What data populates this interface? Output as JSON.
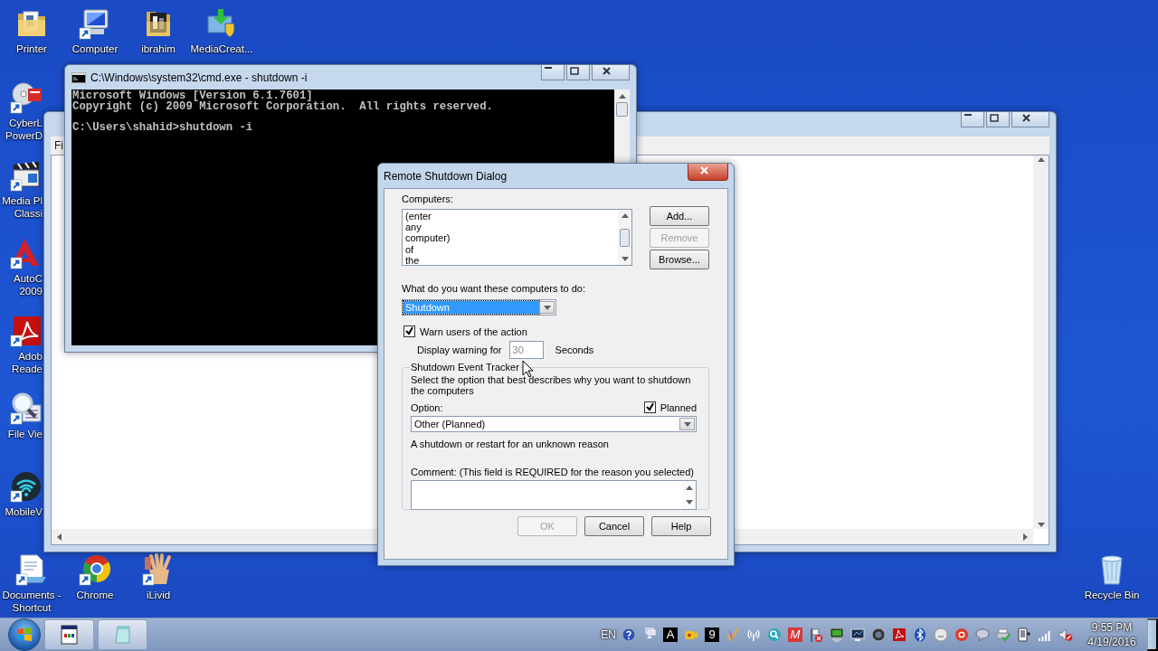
{
  "desktop_icons": {
    "top_row": [
      {
        "label": [
          "Printer"
        ],
        "kind": "folder",
        "shortcut": false
      },
      {
        "label": [
          "Computer"
        ],
        "kind": "computer",
        "shortcut": true
      },
      {
        "label": [
          "ibrahim"
        ],
        "kind": "photo-folder",
        "shortcut": false
      },
      {
        "label": [
          "MediaCreat..."
        ],
        "kind": "installer",
        "shortcut": false
      }
    ],
    "left_column": [
      {
        "label": [
          "CyberL",
          "PowerD"
        ],
        "kind": "disc",
        "shortcut": true
      },
      {
        "label": [
          "Media Pl",
          "Classi"
        ],
        "kind": "clapper",
        "shortcut": true
      },
      {
        "label": [
          "AutoC",
          "2009"
        ],
        "kind": "autocad",
        "shortcut": true
      },
      {
        "label": [
          "Adob",
          "Reade"
        ],
        "kind": "pdf",
        "shortcut": true
      },
      {
        "label": [
          "File Vie"
        ],
        "kind": "magnifier",
        "shortcut": true
      },
      {
        "label": [
          "MobileV"
        ],
        "kind": "wifi",
        "shortcut": true
      }
    ],
    "bottom_row": [
      {
        "label": [
          "Documents -",
          "Shortcut"
        ],
        "kind": "document",
        "shortcut": true
      },
      {
        "label": [
          "Chrome"
        ],
        "kind": "browser",
        "shortcut": true
      },
      {
        "label": [
          "iLivid"
        ],
        "kind": "hand",
        "shortcut": true
      }
    ],
    "right_column": [
      {
        "label": [
          "Recycle Bin"
        ],
        "kind": "bin",
        "shortcut": false
      }
    ]
  },
  "back_window": {
    "menu": "Fi"
  },
  "console_window": {
    "title": "C:\\Windows\\system32\\cmd.exe - shutdown -i",
    "output": [
      "Microsoft Windows [Version 6.1.7601]",
      "Copyright (c) 2009 Microsoft Corporation.  All rights reserved."
    ],
    "prompt": "C:\\Users\\shahid>shutdown -i"
  },
  "dialog": {
    "title": "Remote Shutdown Dialog",
    "computers_label": "Computers:",
    "computers_list": [
      "(enter",
      "any",
      "computer)",
      "of",
      "the"
    ],
    "buttons": [
      {
        "label": "Add...",
        "disabled": false
      },
      {
        "label": "Remove",
        "disabled": true
      },
      {
        "label": "Browse...",
        "disabled": false
      }
    ],
    "action_label": "What do you want these computers to do:",
    "action": {
      "value": "Shutdown",
      "focused": true
    },
    "warn": {
      "label": "Warn users of the action",
      "checked": true
    },
    "warning_label": "Display warning for",
    "warning_value": "30",
    "warning_unit": "Seconds",
    "tracker": {
      "title": "Shutdown Event Tracker",
      "description": "Select the option that best describes why you want to shutdown the computers",
      "option_label": "Option:",
      "planned": {
        "label": "Planned",
        "checked": true
      },
      "option": "Other (Planned)",
      "option_description": "A shutdown or restart for an unknown reason",
      "comment_label": "Comment: (This field is REQUIRED for the reason you selected)"
    },
    "footer_buttons": [
      {
        "label": "OK",
        "disabled": true
      },
      {
        "label": "Cancel",
        "disabled": false
      },
      {
        "label": "Help",
        "disabled": false
      }
    ]
  },
  "taskbar": {
    "tasks": [
      {
        "kind": "window"
      },
      {
        "kind": "notepad"
      }
    ],
    "tray": {
      "language": "EN",
      "icons": [
        {
          "kind": "help"
        },
        {
          "kind": "show-hidden"
        },
        {
          "kind": "letter",
          "glyph": "A"
        },
        {
          "kind": "camera"
        },
        {
          "kind": "letter",
          "glyph": "9"
        },
        {
          "kind": "check"
        },
        {
          "kind": "antenna"
        },
        {
          "kind": "search"
        },
        {
          "kind": "red-letter",
          "glyph": "M"
        },
        {
          "kind": "flag"
        },
        {
          "kind": "monitor-green"
        },
        {
          "kind": "monitor"
        },
        {
          "kind": "webcam"
        },
        {
          "kind": "pdf"
        },
        {
          "kind": "bluetooth"
        },
        {
          "kind": "face"
        },
        {
          "kind": "ring"
        },
        {
          "kind": "speech"
        },
        {
          "kind": "printer"
        },
        {
          "kind": "device"
        },
        {
          "kind": "signal"
        },
        {
          "kind": "speaker-muted"
        }
      ],
      "time": "9:55 PM",
      "date": "4/19/2016"
    }
  }
}
